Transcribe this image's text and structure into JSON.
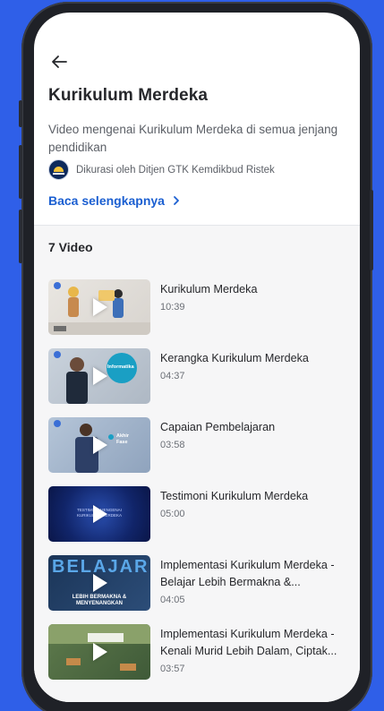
{
  "header": {
    "title": "Kurikulum Merdeka",
    "description": "Video mengenai Kurikulum Merdeka di semua jenjang pendidikan",
    "curator": "Dikurasi oleh Ditjen GTK Kemdikbud Ristek",
    "read_more": "Baca selengkapnya"
  },
  "list": {
    "count_label": "7 Video",
    "videos": [
      {
        "title": "Kurikulum Merdeka",
        "duration": "10:39"
      },
      {
        "title": "Kerangka Kurikulum Merdeka",
        "duration": "04:37"
      },
      {
        "title": "Capaian Pembelajaran",
        "duration": "03:58"
      },
      {
        "title": "Testimoni Kurikulum Merdeka",
        "duration": "05:00"
      },
      {
        "title": "Implementasi Kurikulum Merdeka - Belajar Lebih Bermakna &...",
        "duration": "04:05"
      },
      {
        "title": "Implementasi Kurikulum Merdeka - Kenali Murid Lebih Dalam, Ciptak...",
        "duration": "03:57"
      }
    ]
  },
  "thumbs": {
    "v2_badge": "Informatika",
    "v3_badge": "Akhir Fase",
    "v4_text": "TESTIMONI MENGENAI KURIKULUM MERDEKA",
    "v5_banner": "BELAJAR",
    "v5_caption": "LEBIH BERMAKNA & MENYENANGKAN"
  },
  "colors": {
    "background": "#2f5fe8",
    "accent": "#1b5fd1",
    "text": "#26272b"
  },
  "icons": {
    "back": "arrow-left-icon",
    "chevron": "chevron-right-icon",
    "play": "play-icon"
  }
}
